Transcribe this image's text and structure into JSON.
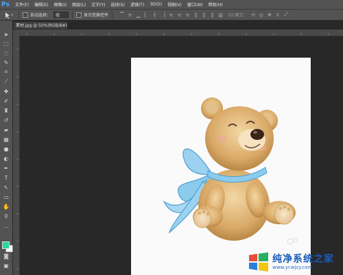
{
  "menubar": {
    "logo": "Ps",
    "items": [
      "文件(F)",
      "编辑(E)",
      "图像(I)",
      "图层(L)",
      "文字(Y)",
      "选择(S)",
      "滤镜(T)",
      "3D(D)",
      "视图(V)",
      "窗口(W)",
      "帮助(H)"
    ]
  },
  "options": {
    "auto_select_label": "自动选择：",
    "auto_select_value": "组",
    "show_transform_label": "显示变换控件",
    "mode3d_label": "3D 模式："
  },
  "document": {
    "tab_title": "素材.jpg @ 50%(RGB/8#)",
    "close": "×"
  },
  "watermark": {
    "title": "纯净系统之家",
    "url": "www.ycwjzy.com"
  },
  "colors": {
    "foreground": "#28d7a0",
    "background": "#ffffff"
  }
}
